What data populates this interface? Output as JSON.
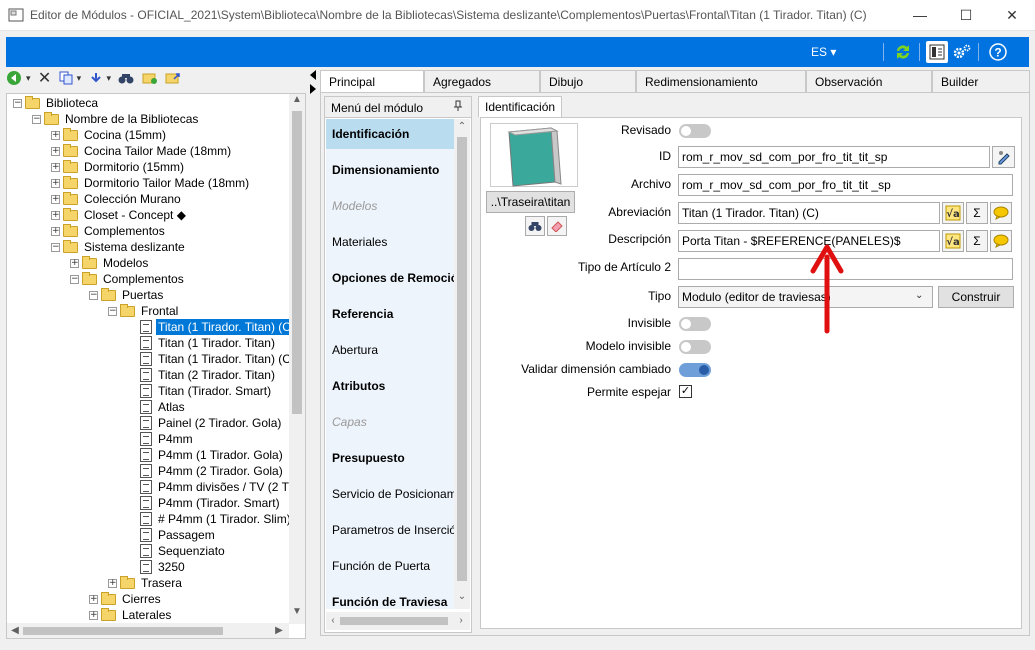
{
  "window": {
    "title": "Editor de Módulos - OFICIAL_2021\\System\\Biblioteca\\Nombre de la Bibliotecas\\Sistema deslizante\\Complementos\\Puertas\\Frontal\\Titan (1 Tirador. Titan) (C)",
    "controls": {
      "minimize": "—",
      "maximize": "☐",
      "close": "✕"
    }
  },
  "header": {
    "language": "ES ▾",
    "colors": {
      "bar": "#0073e0"
    }
  },
  "tree": {
    "items": [
      {
        "label": "Biblioteca",
        "level": 0,
        "kind": "folder",
        "expander": "⊟"
      },
      {
        "label": "Nombre de la Bibliotecas",
        "level": 1,
        "kind": "folder",
        "expander": "⊟"
      },
      {
        "label": "Cocina (15mm)",
        "level": 2,
        "kind": "folder",
        "expander": "+"
      },
      {
        "label": "Cocina Tailor Made (18mm)",
        "level": 2,
        "kind": "folder",
        "expander": "+"
      },
      {
        "label": "Dormitorio (15mm)",
        "level": 2,
        "kind": "folder",
        "expander": "+"
      },
      {
        "label": "Dormitorio Tailor Made (18mm)",
        "level": 2,
        "kind": "folder",
        "expander": "+"
      },
      {
        "label": "Colección Murano",
        "level": 2,
        "kind": "folder",
        "expander": "+"
      },
      {
        "label": "Closet - Concept ◆",
        "level": 2,
        "kind": "folder",
        "expander": "+"
      },
      {
        "label": "Complementos",
        "level": 2,
        "kind": "folder",
        "expander": "+"
      },
      {
        "label": "Sistema deslizante",
        "level": 2,
        "kind": "folder",
        "expander": "−"
      },
      {
        "label": "Modelos",
        "level": 3,
        "kind": "folder",
        "expander": "+"
      },
      {
        "label": "Complementos",
        "level": 3,
        "kind": "folder",
        "expander": "−"
      },
      {
        "label": "Puertas",
        "level": 4,
        "kind": "folder",
        "expander": "−"
      },
      {
        "label": "Frontal",
        "level": 5,
        "kind": "folder",
        "expander": "−"
      },
      {
        "label": "Titan (1 Tirador. Titan) (C",
        "level": 6,
        "kind": "doc",
        "selected": true
      },
      {
        "label": "Titan (1 Tirador. Titan)",
        "level": 6,
        "kind": "doc"
      },
      {
        "label": "Titan (1 Tirador. Titan) (C",
        "level": 6,
        "kind": "doc"
      },
      {
        "label": "Titan (2 Tirador. Titan)",
        "level": 6,
        "kind": "doc"
      },
      {
        "label": "Titan (Tirador. Smart)",
        "level": 6,
        "kind": "doc"
      },
      {
        "label": "Atlas",
        "level": 6,
        "kind": "doc"
      },
      {
        "label": "Painel (2 Tirador. Gola)",
        "level": 6,
        "kind": "doc"
      },
      {
        "label": "P4mm",
        "level": 6,
        "kind": "doc"
      },
      {
        "label": "P4mm (1 Tirador. Gola)",
        "level": 6,
        "kind": "doc"
      },
      {
        "label": "P4mm (2 Tirador. Gola)",
        "level": 6,
        "kind": "doc"
      },
      {
        "label": "P4mm divisões / TV (2 T",
        "level": 6,
        "kind": "doc"
      },
      {
        "label": "P4mm (Tirador. Smart)",
        "level": 6,
        "kind": "doc"
      },
      {
        "label": "# P4mm (1 Tirador. Slim)",
        "level": 6,
        "kind": "doc"
      },
      {
        "label": "Passagem",
        "level": 6,
        "kind": "doc"
      },
      {
        "label": "Sequenziato",
        "level": 6,
        "kind": "doc"
      },
      {
        "label": "3250",
        "level": 6,
        "kind": "doc"
      },
      {
        "label": "Trasera",
        "level": 5,
        "kind": "folder",
        "expander": "+"
      },
      {
        "label": "Cierres",
        "level": 4,
        "kind": "folder",
        "expander": "+"
      },
      {
        "label": "Laterales",
        "level": 4,
        "kind": "folder",
        "expander": "+"
      }
    ]
  },
  "tabs": [
    "Principal",
    "Agregados",
    "Dibujo",
    "Redimensionamiento",
    "Observación",
    "Builder"
  ],
  "menu": {
    "header": "Menú del módulo",
    "pin": "📌",
    "items": [
      {
        "label": "Identificación",
        "style": "bold",
        "active": true
      },
      {
        "label": "Dimensionamiento",
        "style": "bold"
      },
      {
        "label": "Modelos",
        "style": "italic"
      },
      {
        "label": "Materiales",
        "style": "normal"
      },
      {
        "label": "Opciones de Remoción",
        "style": "bold"
      },
      {
        "label": "Referencia",
        "style": "bold"
      },
      {
        "label": "Abertura",
        "style": "normal"
      },
      {
        "label": "Atributos",
        "style": "bold"
      },
      {
        "label": "Capas",
        "style": "italic"
      },
      {
        "label": "Presupuesto",
        "style": "bold"
      },
      {
        "label": "Servicio de Posicionamie",
        "style": "normal"
      },
      {
        "label": "Parametros de Inserción",
        "style": "normal"
      },
      {
        "label": "Función de Puerta",
        "style": "normal"
      },
      {
        "label": "Función de Traviesa",
        "style": "bold"
      }
    ]
  },
  "content": {
    "subtab": "Identificación",
    "image_path_button": "..\\Traseira\\titan",
    "fields": {
      "revisado": {
        "label": "Revisado",
        "on": false
      },
      "id": {
        "label": "ID",
        "value": "rom_r_mov_sd_com_por_fro_tit_tit_sp"
      },
      "archivo": {
        "label": "Archivo",
        "value": "rom_r_mov_sd_com_por_fro_tit_tit _sp"
      },
      "abreviacion": {
        "label": "Abreviación",
        "value": "Titan (1 Tirador. Titan) (C)"
      },
      "descripcion": {
        "label": "Descripción",
        "value": "Porta Titan - $REFERENCE(PANELES)$"
      },
      "tipo_articulo": {
        "label": "Tipo de Artículo 2",
        "value": ""
      },
      "tipo": {
        "label": "Tipo",
        "value": "Modulo (editor de traviesas)",
        "button": "Construir"
      },
      "invisible": {
        "label": "Invisible",
        "on": false
      },
      "modelo_invisible": {
        "label": "Modelo invisible",
        "on": false
      },
      "validar": {
        "label": "Validar dimensión cambiado",
        "on": true
      },
      "permite_espejar": {
        "label": "Permite espejar",
        "checked": true
      }
    },
    "sigma": "Σ",
    "annotation_color": "#e01010"
  }
}
